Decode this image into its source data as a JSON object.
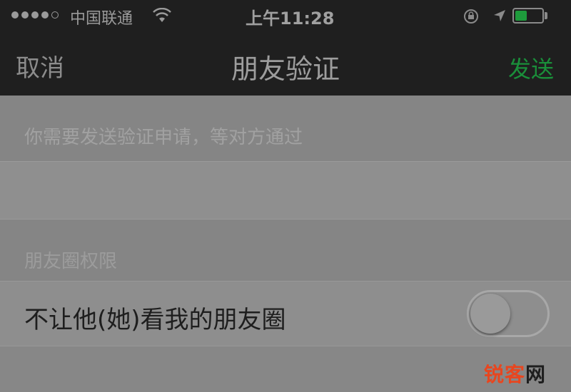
{
  "status_bar": {
    "carrier": "中国联通",
    "time": "上午11:28",
    "signal_bars_filled": 4,
    "signal_bars_total": 5,
    "icons": [
      "wifi-icon",
      "lock-rotation-icon",
      "location-icon",
      "battery-icon"
    ],
    "battery_color": "#1e9b3c"
  },
  "nav": {
    "cancel_label": "取消",
    "title": "朋友验证",
    "send_label": "发送",
    "send_color": "#1a8f3a"
  },
  "verification": {
    "hint": "你需要发送验证申请，等对方通过",
    "message_value": "",
    "message_placeholder": ""
  },
  "moments": {
    "section_title": "朋友圈权限",
    "hide_label": "不让他(她)看我的朋友圈",
    "hide_enabled": false
  },
  "watermark": {
    "text_main": "锐客",
    "text_last": "网"
  }
}
